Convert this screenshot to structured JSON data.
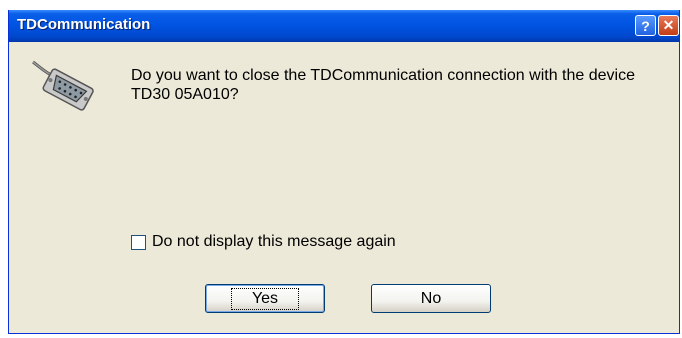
{
  "window": {
    "title": "TDCommunication",
    "help_glyph": "?",
    "close_glyph": "✕"
  },
  "message": {
    "text": "Do you want to close the TDCommunication connection with the device TD30  05A010?",
    "icon": "serial-connector-icon"
  },
  "checkbox": {
    "label": "Do not display this message again",
    "checked": false
  },
  "buttons": {
    "yes_label": "Yes",
    "no_label": "No"
  },
  "colors": {
    "titlebar": "#0054e3",
    "dialog_bg": "#ece9d8",
    "close_button": "#c23d16"
  }
}
